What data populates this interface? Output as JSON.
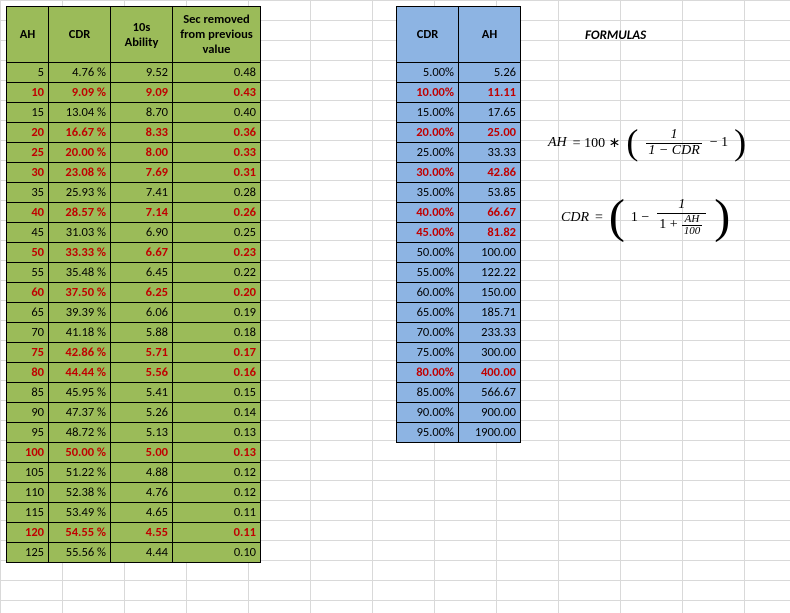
{
  "chart_data": {
    "type": "table",
    "green_table": {
      "headers": [
        "AH",
        "CDR",
        "10s Ability",
        "Sec removed from previous value"
      ],
      "rows_ah": [
        5,
        10,
        15,
        20,
        25,
        30,
        35,
        40,
        45,
        50,
        55,
        60,
        65,
        70,
        75,
        80,
        85,
        90,
        95,
        100,
        105,
        110,
        115,
        120,
        125
      ],
      "rows_cdr_percent": [
        4.76,
        9.09,
        13.04,
        16.67,
        20.0,
        23.08,
        25.93,
        28.57,
        31.03,
        33.33,
        35.48,
        37.5,
        39.39,
        41.18,
        42.86,
        44.44,
        45.95,
        47.37,
        48.72,
        50.0,
        51.22,
        52.38,
        53.49,
        54.55,
        55.56
      ],
      "rows_10s_ability": [
        9.52,
        9.09,
        8.7,
        8.33,
        8.0,
        7.69,
        7.41,
        7.14,
        6.9,
        6.67,
        6.45,
        6.25,
        6.06,
        5.88,
        5.71,
        5.56,
        5.41,
        5.26,
        5.13,
        5.0,
        4.88,
        4.76,
        4.65,
        4.55,
        4.44
      ],
      "rows_sec_removed": [
        0.48,
        0.43,
        0.4,
        0.36,
        0.33,
        0.31,
        0.28,
        0.26,
        0.25,
        0.23,
        0.22,
        0.2,
        0.19,
        0.18,
        0.17,
        0.16,
        0.15,
        0.14,
        0.13,
        0.13,
        0.12,
        0.12,
        0.11,
        0.11,
        0.1
      ],
      "highlighted_rows_idx": [
        1,
        3,
        4,
        5,
        7,
        9,
        11,
        14,
        15,
        19,
        23
      ]
    },
    "blue_table": {
      "headers": [
        "CDR",
        "AH"
      ],
      "rows_cdr_percent": [
        5,
        10,
        15,
        20,
        25,
        30,
        35,
        40,
        45,
        50,
        55,
        60,
        65,
        70,
        75,
        80,
        85,
        90,
        95
      ],
      "rows_ah": [
        5.26,
        11.11,
        17.65,
        25.0,
        33.33,
        42.86,
        53.85,
        66.67,
        81.82,
        100.0,
        122.22,
        150.0,
        185.71,
        233.33,
        300.0,
        400.0,
        566.67,
        900.0,
        1900.0
      ],
      "highlighted_rows_idx": [
        1,
        3,
        5,
        7,
        8,
        15
      ]
    }
  },
  "green": {
    "h1": "AH",
    "h2": "CDR",
    "h3": "10s Ability",
    "h4": "Sec removed\nfrom\nprevious value",
    "rows": [
      {
        "c1": "5",
        "c2": "4.76 %",
        "c3": "9.52",
        "c4": "0.48",
        "hl": false
      },
      {
        "c1": "10",
        "c2": "9.09 %",
        "c3": "9.09",
        "c4": "0.43",
        "hl": true
      },
      {
        "c1": "15",
        "c2": "13.04 %",
        "c3": "8.70",
        "c4": "0.40",
        "hl": false
      },
      {
        "c1": "20",
        "c2": "16.67 %",
        "c3": "8.33",
        "c4": "0.36",
        "hl": true
      },
      {
        "c1": "25",
        "c2": "20.00 %",
        "c3": "8.00",
        "c4": "0.33",
        "hl": true
      },
      {
        "c1": "30",
        "c2": "23.08 %",
        "c3": "7.69",
        "c4": "0.31",
        "hl": true
      },
      {
        "c1": "35",
        "c2": "25.93 %",
        "c3": "7.41",
        "c4": "0.28",
        "hl": false
      },
      {
        "c1": "40",
        "c2": "28.57 %",
        "c3": "7.14",
        "c4": "0.26",
        "hl": true
      },
      {
        "c1": "45",
        "c2": "31.03 %",
        "c3": "6.90",
        "c4": "0.25",
        "hl": false
      },
      {
        "c1": "50",
        "c2": "33.33 %",
        "c3": "6.67",
        "c4": "0.23",
        "hl": true
      },
      {
        "c1": "55",
        "c2": "35.48 %",
        "c3": "6.45",
        "c4": "0.22",
        "hl": false
      },
      {
        "c1": "60",
        "c2": "37.50 %",
        "c3": "6.25",
        "c4": "0.20",
        "hl": true
      },
      {
        "c1": "65",
        "c2": "39.39 %",
        "c3": "6.06",
        "c4": "0.19",
        "hl": false
      },
      {
        "c1": "70",
        "c2": "41.18 %",
        "c3": "5.88",
        "c4": "0.18",
        "hl": false
      },
      {
        "c1": "75",
        "c2": "42.86 %",
        "c3": "5.71",
        "c4": "0.17",
        "hl": true
      },
      {
        "c1": "80",
        "c2": "44.44 %",
        "c3": "5.56",
        "c4": "0.16",
        "hl": true
      },
      {
        "c1": "85",
        "c2": "45.95 %",
        "c3": "5.41",
        "c4": "0.15",
        "hl": false
      },
      {
        "c1": "90",
        "c2": "47.37 %",
        "c3": "5.26",
        "c4": "0.14",
        "hl": false
      },
      {
        "c1": "95",
        "c2": "48.72 %",
        "c3": "5.13",
        "c4": "0.13",
        "hl": false
      },
      {
        "c1": "100",
        "c2": "50.00 %",
        "c3": "5.00",
        "c4": "0.13",
        "hl": true
      },
      {
        "c1": "105",
        "c2": "51.22 %",
        "c3": "4.88",
        "c4": "0.12",
        "hl": false
      },
      {
        "c1": "110",
        "c2": "52.38 %",
        "c3": "4.76",
        "c4": "0.12",
        "hl": false
      },
      {
        "c1": "115",
        "c2": "53.49 %",
        "c3": "4.65",
        "c4": "0.11",
        "hl": false
      },
      {
        "c1": "120",
        "c2": "54.55 %",
        "c3": "4.55",
        "c4": "0.11",
        "hl": true
      },
      {
        "c1": "125",
        "c2": "55.56 %",
        "c3": "4.44",
        "c4": "0.10",
        "hl": false
      }
    ]
  },
  "blue": {
    "h1": "CDR",
    "h2": "AH",
    "rows": [
      {
        "c1": "5.00%",
        "c2": "5.26",
        "hl": false
      },
      {
        "c1": "10.00%",
        "c2": "11.11",
        "hl": true
      },
      {
        "c1": "15.00%",
        "c2": "17.65",
        "hl": false
      },
      {
        "c1": "20.00%",
        "c2": "25.00",
        "hl": true
      },
      {
        "c1": "25.00%",
        "c2": "33.33",
        "hl": false
      },
      {
        "c1": "30.00%",
        "c2": "42.86",
        "hl": true
      },
      {
        "c1": "35.00%",
        "c2": "53.85",
        "hl": false
      },
      {
        "c1": "40.00%",
        "c2": "66.67",
        "hl": true
      },
      {
        "c1": "45.00%",
        "c2": "81.82",
        "hl": true
      },
      {
        "c1": "50.00%",
        "c2": "100.00",
        "hl": false
      },
      {
        "c1": "55.00%",
        "c2": "122.22",
        "hl": false
      },
      {
        "c1": "60.00%",
        "c2": "150.00",
        "hl": false
      },
      {
        "c1": "65.00%",
        "c2": "185.71",
        "hl": false
      },
      {
        "c1": "70.00%",
        "c2": "233.33",
        "hl": false
      },
      {
        "c1": "75.00%",
        "c2": "300.00",
        "hl": false
      },
      {
        "c1": "80.00%",
        "c2": "400.00",
        "hl": true
      },
      {
        "c1": "85.00%",
        "c2": "566.67",
        "hl": false
      },
      {
        "c1": "90.00%",
        "c2": "900.00",
        "hl": false
      },
      {
        "c1": "95.00%",
        "c2": "1900.00",
        "hl": false
      }
    ]
  },
  "formulas": {
    "label": "FORMULAS",
    "ah_lhs": "AH",
    "ah_coef": "= 100 ∗",
    "ah_frac_num": "1",
    "ah_frac_den": "1 − CDR",
    "ah_minus1": "− 1",
    "cdr_lhs": "CDR",
    "cdr_eq": "=",
    "cdr_one": "1 −",
    "cdr_frac_num": "1",
    "cdr_frac_den_1plus": "1 +",
    "cdr_inner_num": "AH",
    "cdr_inner_den": "100"
  }
}
